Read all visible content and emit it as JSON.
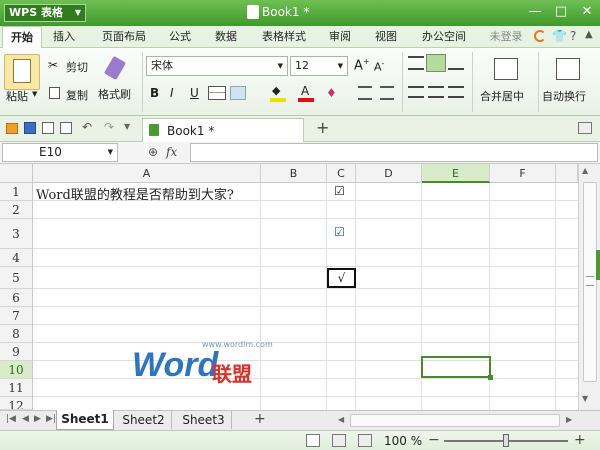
{
  "titlebar": {
    "app_label": "WPS 表格",
    "doc_title": "Book1 *"
  },
  "menu": {
    "tabs": [
      "开始",
      "插入",
      "页面布局",
      "公式",
      "数据",
      "表格样式",
      "审阅",
      "视图",
      "办公空间"
    ],
    "login": "未登录"
  },
  "ribbon": {
    "paste": "粘贴",
    "cut": "剪切",
    "copy": "复制",
    "format_painter": "格式刷",
    "font_name": "宋体",
    "font_size": "12",
    "bold": "B",
    "italic": "I",
    "underline": "U",
    "font_color_glyph": "A",
    "merge_center": "合并居中",
    "wrap_text": "自动换行"
  },
  "quickbar": {
    "doc_tab": "Book1 *",
    "add_tab": "+"
  },
  "formula": {
    "cell_ref": "E10",
    "fx": "fx",
    "value": ""
  },
  "columns": [
    "A",
    "B",
    "C",
    "D",
    "E",
    "F"
  ],
  "rows": [
    "1",
    "2",
    "3",
    "4",
    "5",
    "6",
    "7",
    "8",
    "9",
    "10",
    "11",
    "12"
  ],
  "cells": {
    "A1": "Word联盟的教程是否帮助到大家?"
  },
  "checkboxes": {
    "C1": "☑",
    "C3": "☑",
    "C5": "√"
  },
  "watermark": {
    "word": "Word",
    "cn": "联盟",
    "url": "www.wordlm.com"
  },
  "sheets": [
    "Sheet1",
    "Sheet2",
    "Sheet3"
  ],
  "status": {
    "zoom": "100 %",
    "minus": "−",
    "plus": "+"
  },
  "colors": {
    "accent": "#4a9a32",
    "active_cell": "#4a8a2a",
    "header_active": "#d8ecc9"
  }
}
